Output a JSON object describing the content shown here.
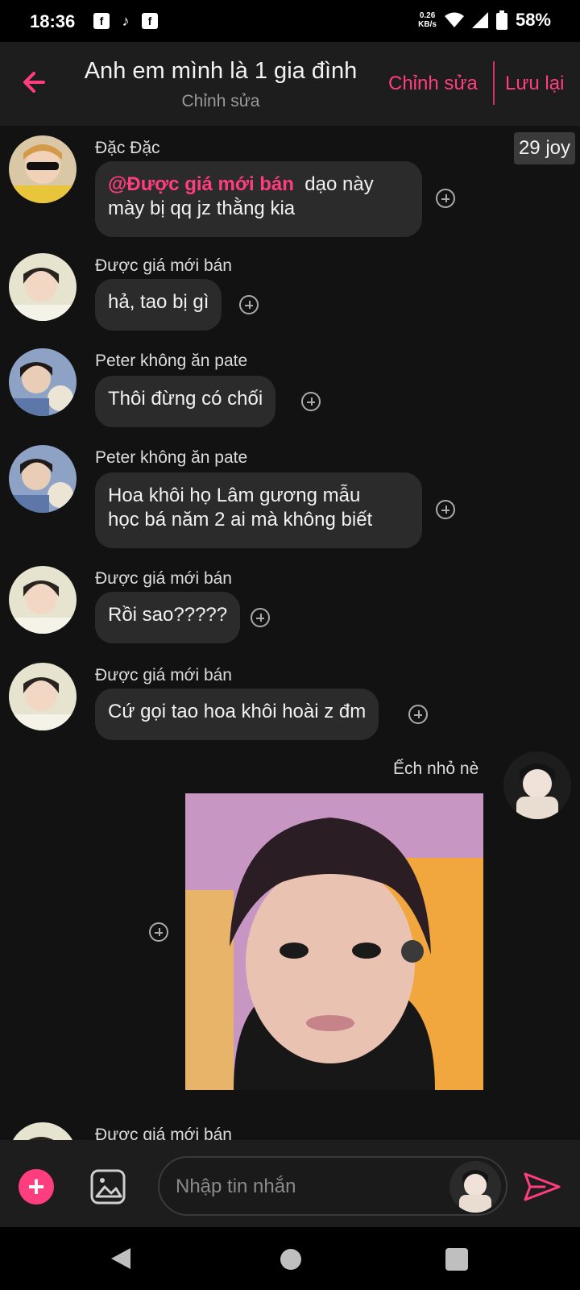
{
  "status_bar": {
    "time": "18:36",
    "network_speed": "0.26",
    "network_unit": "KB/s",
    "battery": "58%"
  },
  "header": {
    "title": "Anh em mình là 1 gia đình",
    "subtitle": "Chỉnh sửa",
    "edit_label": "Chỉnh sửa",
    "save_label": "Lưu lại"
  },
  "badge": {
    "joy": "29 joy"
  },
  "messages": [
    {
      "sender": "Đặc Đặc",
      "mention": "@Được giá mới bán",
      "text_line1": "dạo này",
      "text_line2": "mày bị qq jz thằng kia"
    },
    {
      "sender": "Được giá mới bán",
      "text": "hả, tao bị gì"
    },
    {
      "sender": "Peter không ăn pate",
      "text": "Thôi đừng có chối"
    },
    {
      "sender": "Peter không ăn pate",
      "text_line1": "Hoa khôi họ Lâm gương mẫu",
      "text_line2": "học bá  năm 2 ai mà không biết"
    },
    {
      "sender": "Được giá mới bán",
      "text": "Rồi sao?????"
    },
    {
      "sender": "Được giá mới bán",
      "text": "Cứ gọi tao hoa khôi hoài z đm"
    },
    {
      "sender": "Ếch nhỏ nè"
    },
    {
      "sender": "Được giá mới bán"
    }
  ],
  "composer": {
    "placeholder": "Nhập tin nhắn"
  },
  "colors": {
    "accent": "#ff3d7f",
    "background": "#121212",
    "bubble": "#2b2b2b",
    "header": "#1d1d1d"
  }
}
